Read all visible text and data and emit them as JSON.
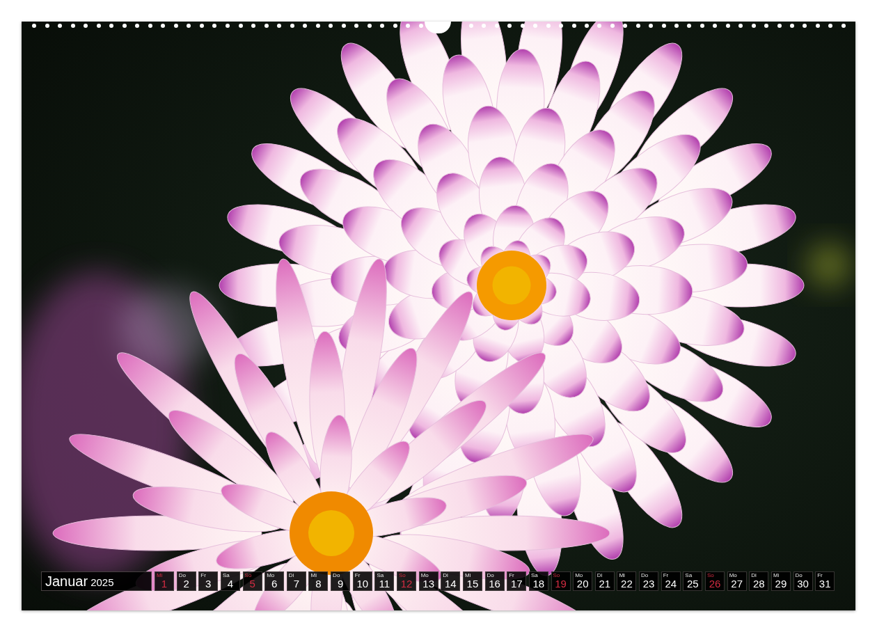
{
  "calendar": {
    "month": "Januar",
    "year": "2025",
    "days": [
      {
        "weekday": "Mi",
        "day": "1",
        "highlighted": true
      },
      {
        "weekday": "Do",
        "day": "2",
        "highlighted": false
      },
      {
        "weekday": "Fr",
        "day": "3",
        "highlighted": false
      },
      {
        "weekday": "Sa",
        "day": "4",
        "highlighted": false
      },
      {
        "weekday": "So",
        "day": "5",
        "highlighted": true
      },
      {
        "weekday": "Mo",
        "day": "6",
        "highlighted": false
      },
      {
        "weekday": "Di",
        "day": "7",
        "highlighted": false
      },
      {
        "weekday": "Mi",
        "day": "8",
        "highlighted": false
      },
      {
        "weekday": "Do",
        "day": "9",
        "highlighted": false
      },
      {
        "weekday": "Fr",
        "day": "10",
        "highlighted": false
      },
      {
        "weekday": "Sa",
        "day": "11",
        "highlighted": false
      },
      {
        "weekday": "So",
        "day": "12",
        "highlighted": true
      },
      {
        "weekday": "Mo",
        "day": "13",
        "highlighted": false
      },
      {
        "weekday": "Di",
        "day": "14",
        "highlighted": false
      },
      {
        "weekday": "Mi",
        "day": "15",
        "highlighted": false
      },
      {
        "weekday": "Do",
        "day": "16",
        "highlighted": false
      },
      {
        "weekday": "Fr",
        "day": "17",
        "highlighted": false
      },
      {
        "weekday": "Sa",
        "day": "18",
        "highlighted": false
      },
      {
        "weekday": "So",
        "day": "19",
        "highlighted": true
      },
      {
        "weekday": "Mo",
        "day": "20",
        "highlighted": false
      },
      {
        "weekday": "Di",
        "day": "21",
        "highlighted": false
      },
      {
        "weekday": "Mi",
        "day": "22",
        "highlighted": false
      },
      {
        "weekday": "Do",
        "day": "23",
        "highlighted": false
      },
      {
        "weekday": "Fr",
        "day": "24",
        "highlighted": false
      },
      {
        "weekday": "Sa",
        "day": "25",
        "highlighted": false
      },
      {
        "weekday": "So",
        "day": "26",
        "highlighted": true
      },
      {
        "weekday": "Mo",
        "day": "27",
        "highlighted": false
      },
      {
        "weekday": "Di",
        "day": "28",
        "highlighted": false
      },
      {
        "weekday": "Mi",
        "day": "29",
        "highlighted": false
      },
      {
        "weekday": "Do",
        "day": "30",
        "highlighted": false
      },
      {
        "weekday": "Fr",
        "day": "31",
        "highlighted": false
      }
    ]
  }
}
